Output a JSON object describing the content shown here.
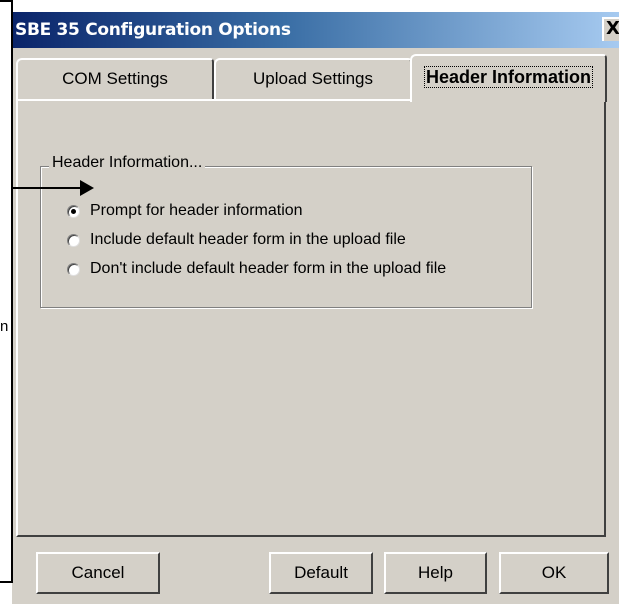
{
  "window": {
    "title": "SBE 35 Configuration Options",
    "close_label": "X"
  },
  "tabs": [
    {
      "label": "COM Settings",
      "selected": false
    },
    {
      "label": "Upload Settings",
      "selected": false
    },
    {
      "label": "Header Information",
      "selected": true
    }
  ],
  "group": {
    "legend": "Header Information...",
    "options": [
      {
        "label": "Prompt for header information",
        "checked": true
      },
      {
        "label": "Include default header form in the upload file",
        "checked": false
      },
      {
        "label": "Don't include default header form in the upload file",
        "checked": false
      }
    ]
  },
  "buttons": {
    "cancel": "Cancel",
    "default": "Default",
    "help": "Help",
    "ok": "OK"
  },
  "callout": {
    "fragment": "n"
  }
}
